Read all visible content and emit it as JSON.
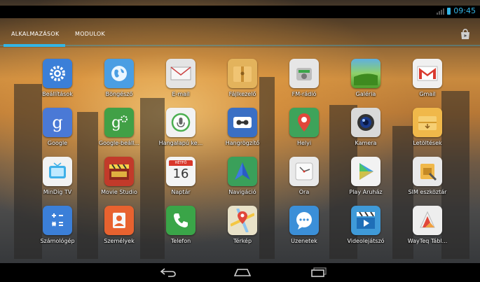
{
  "status": {
    "time": "09:45"
  },
  "tabs": [
    {
      "label": "ALKALMAZÁSOK",
      "active": true
    },
    {
      "label": "MODULOK",
      "active": false
    }
  ],
  "colors": {
    "accent": "#33b5e5"
  },
  "apps": [
    {
      "label": "Beállítások",
      "icon": "settings-gear-icon",
      "color": "#3b7fd8"
    },
    {
      "label": "Böngésző",
      "icon": "globe-browser-icon",
      "color": "#4a9ee3"
    },
    {
      "label": "E-mail",
      "icon": "envelope-icon",
      "color": "#e4e4e4"
    },
    {
      "label": "Fájlkezelő",
      "icon": "folder-icon",
      "color": "#e3b35c"
    },
    {
      "label": "FM-rádió",
      "icon": "radio-icon",
      "color": "#e6e6e6"
    },
    {
      "label": "Galéria",
      "icon": "gallery-icon",
      "color": "#6fb93a"
    },
    {
      "label": "Gmail",
      "icon": "gmail-icon",
      "color": "#f0f0f0"
    },
    {
      "label": "Google",
      "icon": "google-search-icon",
      "color": "#4a79d6"
    },
    {
      "label": "Google-beáll...",
      "icon": "google-settings-icon",
      "color": "#41a046"
    },
    {
      "label": "Hangalapú ke...",
      "icon": "microphone-icon",
      "color": "#f2f2f2"
    },
    {
      "label": "Hangrögzítő",
      "icon": "recorder-icon",
      "color": "#3a6fc4"
    },
    {
      "label": "Helyi",
      "icon": "maps-pin-icon",
      "color": "#3ea35a"
    },
    {
      "label": "Kamera",
      "icon": "camera-icon",
      "color": "#d9d9d9"
    },
    {
      "label": "Letöltések",
      "icon": "downloads-icon",
      "color": "#f0b84a"
    },
    {
      "label": "MinDig TV",
      "icon": "tv-icon",
      "color": "#f2f2f2"
    },
    {
      "label": "Movie Studio",
      "icon": "clapperboard-icon",
      "color": "#c23a2a"
    },
    {
      "label": "Naptár",
      "icon": "calendar-icon",
      "color": "#f4f4f4"
    },
    {
      "label": "Navigáció",
      "icon": "navigation-arrow-icon",
      "color": "#3aa05a"
    },
    {
      "label": "Óra",
      "icon": "clock-icon",
      "color": "#e9e9e9"
    },
    {
      "label": "Play Áruház",
      "icon": "play-store-icon",
      "color": "#f2f2f2"
    },
    {
      "label": "SIM eszköztár",
      "icon": "sim-toolkit-icon",
      "color": "#e9e9e9"
    },
    {
      "label": "Számológép",
      "icon": "calculator-icon",
      "color": "#3b7fd8"
    },
    {
      "label": "Személyek",
      "icon": "contacts-icon",
      "color": "#e8622f"
    },
    {
      "label": "Telefon",
      "icon": "phone-icon",
      "color": "#3aa548"
    },
    {
      "label": "Térkép",
      "icon": "map-icon",
      "color": "#e9e2c8"
    },
    {
      "label": "Üzenetek",
      "icon": "messages-icon",
      "color": "#3b8fd8"
    },
    {
      "label": "Videolejátszó",
      "icon": "video-player-icon",
      "color": "#3f9ad8"
    },
    {
      "label": "WayTeq Tábl...",
      "icon": "wayteq-icon",
      "color": "#eeeeee"
    }
  ],
  "calendar_icon": {
    "day": "16",
    "header": "HÉTFŐ"
  }
}
